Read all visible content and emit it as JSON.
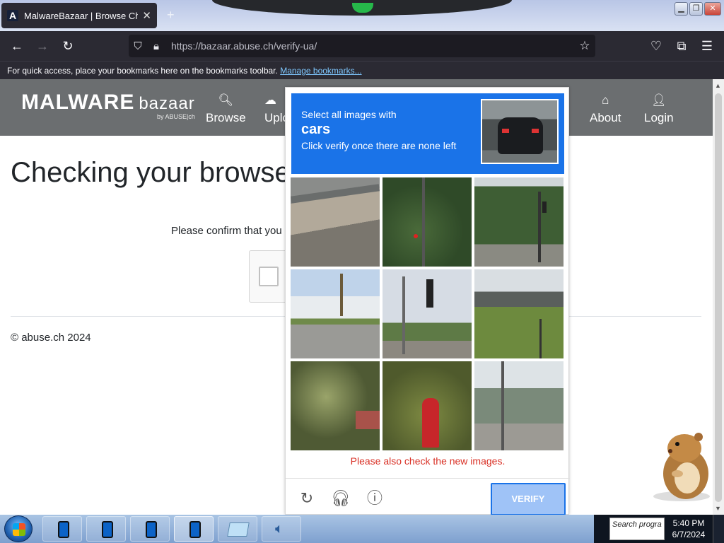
{
  "browser": {
    "tab_title": "MalwareBazaar | Browse Checking",
    "tab_favicon": "A",
    "url": "https://bazaar.abuse.ch/verify-ua/",
    "bookmarks_text": "For quick access, place your bookmarks here on the bookmarks toolbar.",
    "bookmarks_link": "Manage bookmarks..."
  },
  "site": {
    "logo_main": "MALWARE",
    "logo_sub": "bazaar",
    "logo_by": "by ABUSE|ch",
    "nav": [
      {
        "label": "Browse",
        "icon": "search-icon"
      },
      {
        "label": "Uplo",
        "icon": "upload-icon"
      },
      {
        "label": "About",
        "icon": "building-icon"
      },
      {
        "label": "Login",
        "icon": "user-icon"
      }
    ],
    "heading": "Checking your browse",
    "confirm_text": "Please confirm that you",
    "copyright": "© abuse.ch 2024"
  },
  "captcha": {
    "line1": "Select all images with",
    "line2": "cars",
    "line3": "Click verify once there are none left",
    "new_images_msg": "Please also check the new images.",
    "verify_label": "VERIFY",
    "tiles": [
      "guardrail",
      "trees-traffic-light",
      "trees-traffic-light",
      "house-palm-tree",
      "traffic-light-pole",
      "overpass",
      "palm-shrub",
      "fire-hydrant",
      "street-building"
    ],
    "accent": "#1a73e8",
    "error_color": "#d93025"
  },
  "taskbar": {
    "search_placeholder": "Search progra",
    "time": "5:40 PM",
    "date": "6/7/2024"
  }
}
